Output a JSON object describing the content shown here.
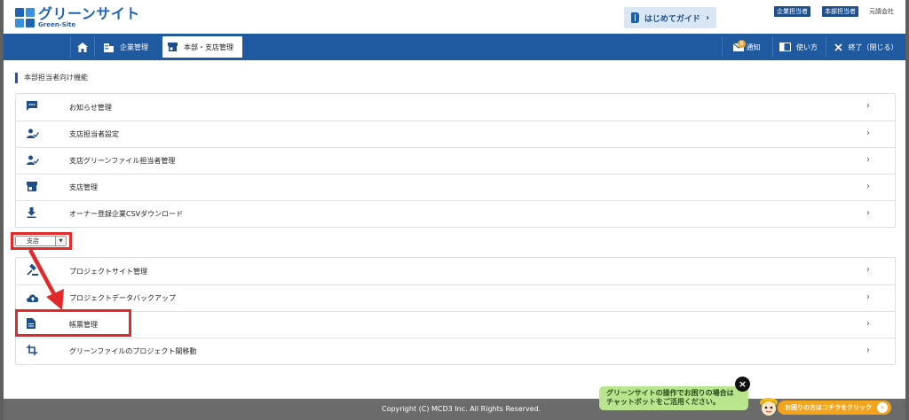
{
  "header": {
    "logo_title": "グリーンサイト",
    "logo_sub": "Green-Site",
    "guide_label": "はじめてガイド",
    "badges": [
      "企業担当者",
      "本部担当者"
    ],
    "company_link": "元請会社"
  },
  "nav": {
    "corp": "企業管理",
    "hq": "本部・支店管理",
    "notice": "通知",
    "notice_count": "8",
    "howto": "使い方",
    "exit": "終了（閉じる）"
  },
  "main": {
    "section_title": "本部担当者向け機能",
    "hq_items": [
      {
        "label": "お知らせ管理",
        "icon": "message-icon"
      },
      {
        "label": "支店担当者設定",
        "icon": "user-check-icon"
      },
      {
        "label": "支店グリーンファイル担当者管理",
        "icon": "user-check-icon"
      },
      {
        "label": "支店管理",
        "icon": "store-icon"
      },
      {
        "label": "オーナー登録企業CSVダウンロード",
        "icon": "download-icon"
      }
    ],
    "branch_select_value": "支店",
    "branch_items": [
      {
        "label": "プロジェクトサイト管理",
        "icon": "gavel-icon"
      },
      {
        "label": "プロジェクトデータバックアップ",
        "icon": "cloud-upload-icon"
      },
      {
        "label": "帳票管理",
        "icon": "document-icon"
      },
      {
        "label": "グリーンファイルのプロジェクト間移動",
        "icon": "crop-icon"
      }
    ]
  },
  "footer": {
    "copyright": "Copyright (C) MCD3 Inc. All Rights Reserved."
  },
  "chat": {
    "bubble_line1": "グリーンサイトの操作でお困りの場合は",
    "bubble_line2": "チャットボットをご活用ください。",
    "cta": "お困りの方はコチラをクリック"
  },
  "colors": {
    "primary": "#1f5aa0",
    "highlight": "#e32a2a",
    "chat_green": "#b9e58f",
    "chat_orange": "#f3a31c"
  }
}
